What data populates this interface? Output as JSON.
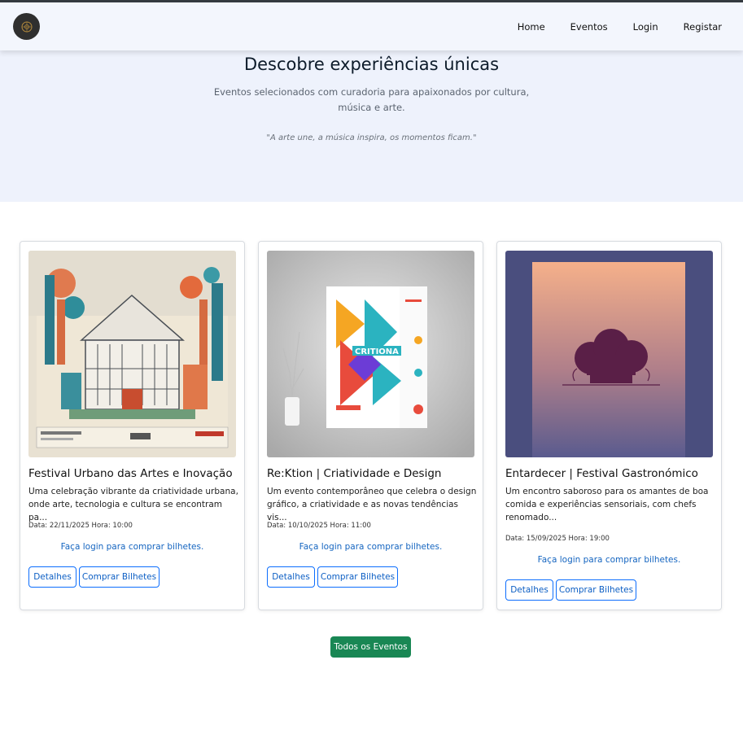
{
  "nav": {
    "logo": "logo-icon",
    "links": [
      "Home",
      "Eventos",
      "Login",
      "Registar"
    ]
  },
  "hero": {
    "title": "Descobre experiências únicas",
    "lead": "Eventos selecionados com curadoria para apaixonados por cultura, música e arte.",
    "quote": "\"A arte une, a música inspira, os momentos ficam.\""
  },
  "events": [
    {
      "title": "Festival Urbano das Artes e Inovação",
      "description": "Uma celebração vibrante da criatividade urbana, onde arte, tecnologia e cultura se encontram pa...",
      "meta": "Data: 22/11/2025 Hora: 10:00",
      "login_text": "Faça login para comprar bilhetes.",
      "details_label": "Detalhes",
      "buy_label": "Comprar Bilhetes",
      "image": "urban-festival-poster-image"
    },
    {
      "title": "Re:Ktion | Criatividade e Design",
      "description": "Um evento contemporâneo que celebra o design gráfico, a criatividade e as novas tendências vis...",
      "meta": "Data: 10/10/2025 Hora: 11:00",
      "login_text": "Faça login para comprar bilhetes.",
      "details_label": "Detalhes",
      "buy_label": "Comprar Bilhetes",
      "image": "design-poster-mockup-image"
    },
    {
      "title": "Entardecer | Festival Gastronómico",
      "description": "Um encontro saboroso para os amantes de boa comida e experiências sensoriais, com chefs renomado...",
      "meta": "Data: 15/09/2025 Hora: 19:00",
      "login_text": "Faça login para comprar bilhetes.",
      "details_label": "Detalhes",
      "buy_label": "Comprar Bilhetes",
      "image": "chef-hat-sunset-image"
    }
  ],
  "all_events_label": "Todos os Eventos",
  "colors": {
    "accent": "#0d6efd",
    "success": "#198754",
    "hero_bg": "#eef2fc"
  }
}
